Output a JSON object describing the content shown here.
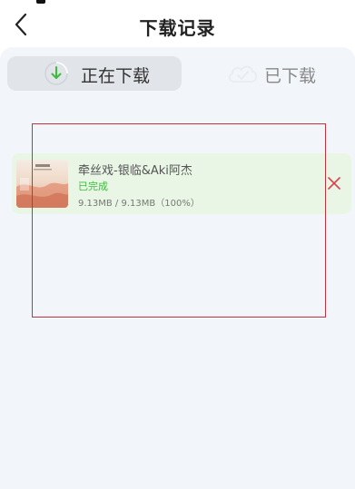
{
  "header": {
    "title": "下载记录",
    "back_icon": "chevron-left-icon"
  },
  "tabs": [
    {
      "label": "正在下载",
      "icon": "download-arrow-icon",
      "active": true
    },
    {
      "label": "已下载",
      "icon": "cloud-check-icon",
      "active": false
    }
  ],
  "downloads": [
    {
      "title": "牵丝戏-银临&Aki阿杰",
      "status": "已完成",
      "size": "9.13MB / 9.13MB（100%）",
      "progress": 1.0,
      "status_color": "#3dbb3d",
      "delete_icon": "close-icon",
      "delete_color": "#d9434a"
    }
  ],
  "colors": {
    "accent_green": "#3dbb3d",
    "item_bg": "#e9f6e5",
    "content_bg": "#f2f5f9",
    "highlight_border": "#c0343d"
  }
}
